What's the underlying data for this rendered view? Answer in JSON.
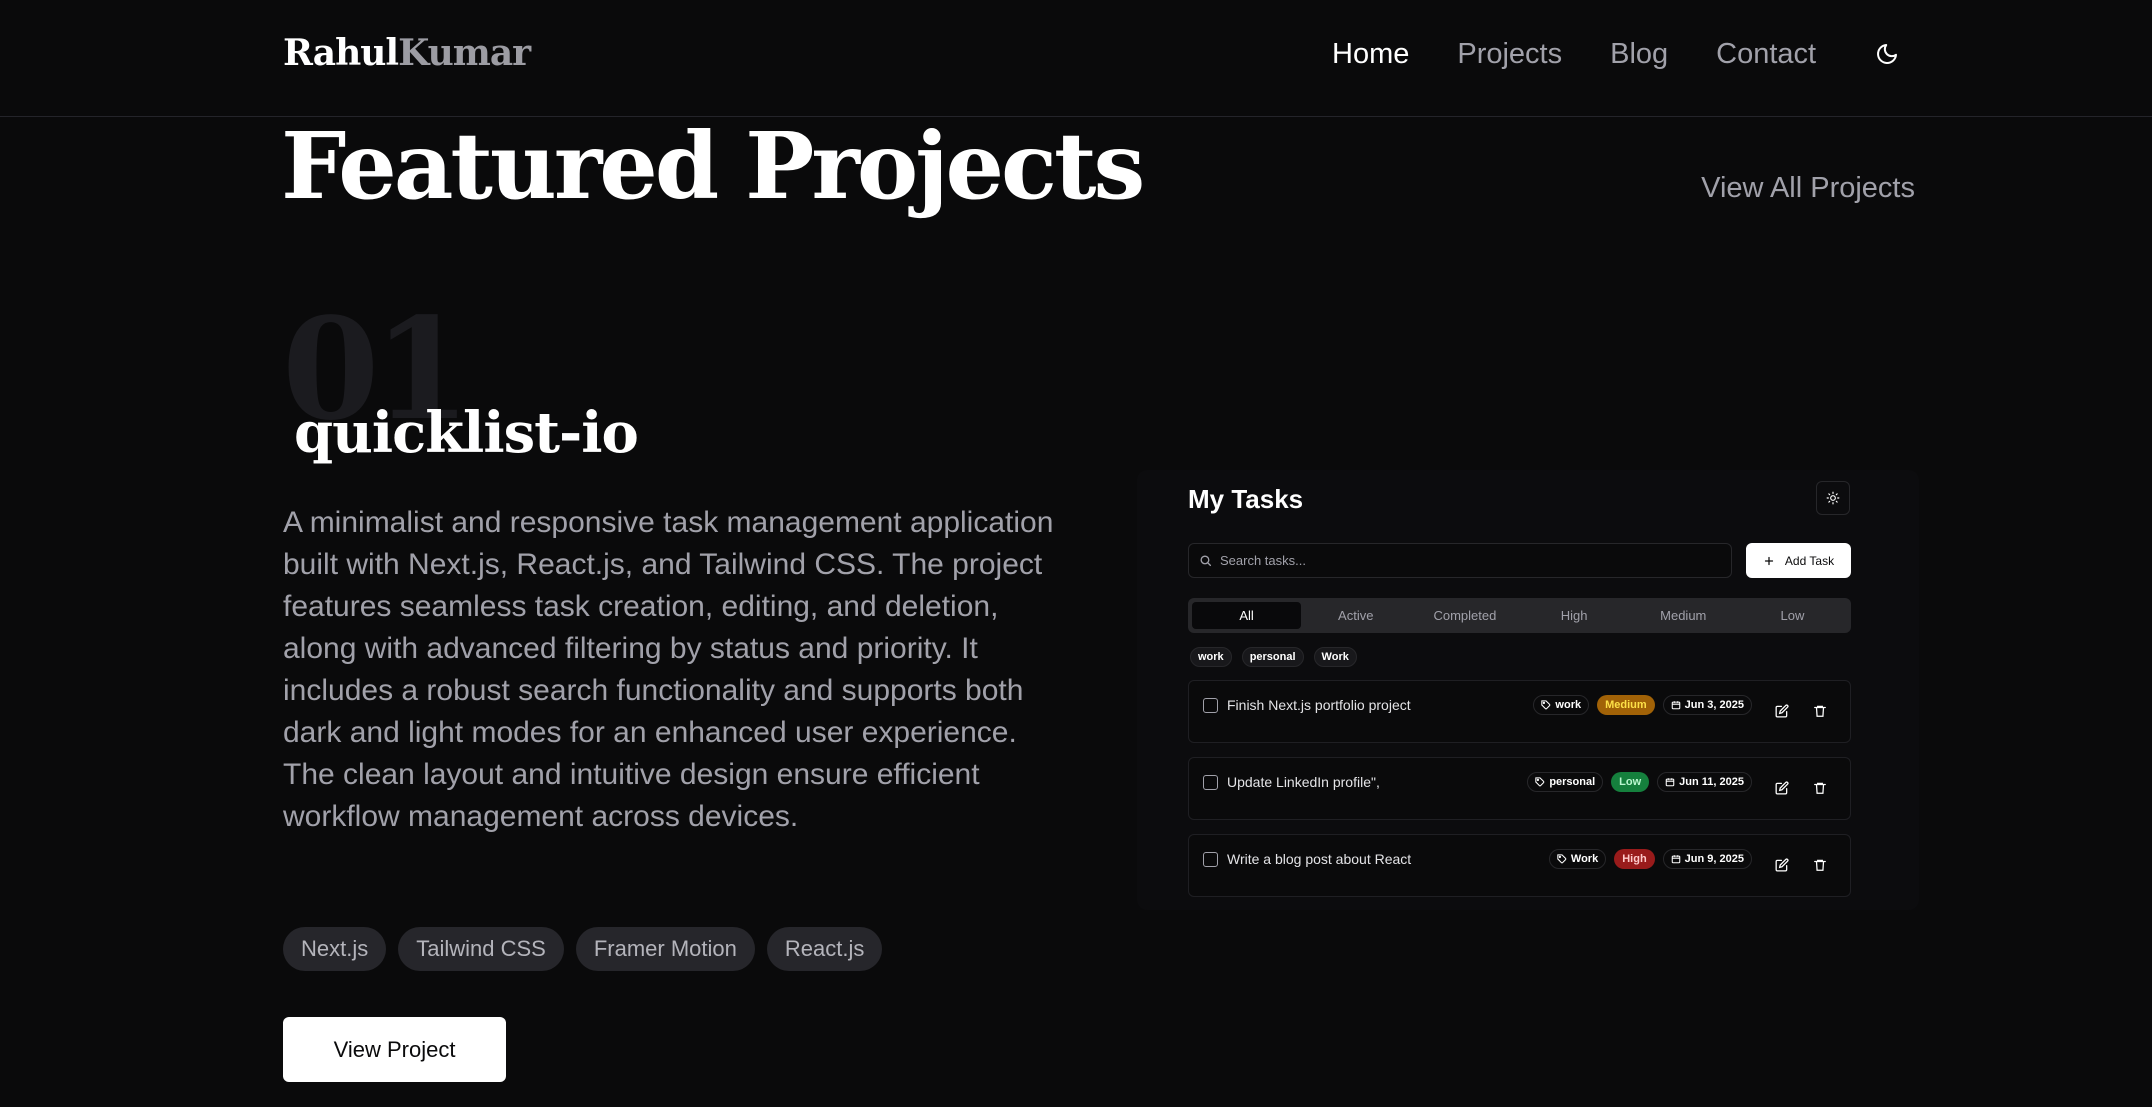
{
  "header": {
    "logo_first": "Rahul",
    "logo_last": "Kumar",
    "nav": [
      {
        "label": "Home",
        "active": true
      },
      {
        "label": "Projects",
        "active": false
      },
      {
        "label": "Blog",
        "active": false
      },
      {
        "label": "Contact",
        "active": false
      }
    ],
    "theme_icon": "moon-icon"
  },
  "section": {
    "title": "Featured Projects",
    "view_all": "View All Projects"
  },
  "project": {
    "number": "01",
    "title": "quicklist-io",
    "description": "A minimalist and responsive task management application built with Next.js, React.js, and Tailwind CSS. The project features seamless task creation, editing, and deletion, along with advanced filtering by status and priority. It includes a robust search functionality and supports both dark and light modes for an enhanced user experience. The clean layout and intuitive design ensure efficient workflow management across devices.",
    "tags": [
      "Next.js",
      "Tailwind CSS",
      "Framer Motion",
      "React.js"
    ],
    "cta": "View Project"
  },
  "preview": {
    "title": "My Tasks",
    "theme_icon": "sun-icon",
    "search_placeholder": "Search tasks...",
    "add_task": "Add Task",
    "filters": [
      "All",
      "Active",
      "Completed",
      "High",
      "Medium",
      "Low"
    ],
    "active_filter": "All",
    "categories": [
      "work",
      "personal",
      "Work"
    ],
    "tasks": [
      {
        "text": "Finish Next.js portfolio project",
        "category": "work",
        "priority": "Medium",
        "priority_bg": "#a16207",
        "priority_fg": "#fde047",
        "date": "Jun 3, 2025"
      },
      {
        "text": "Update LinkedIn profile\",",
        "category": "personal",
        "priority": "Low",
        "priority_bg": "#15803d",
        "priority_fg": "#bbf7d0",
        "date": "Jun 11, 2025"
      },
      {
        "text": "Write a blog post about React",
        "category": "Work",
        "priority": "High",
        "priority_bg": "#991b1b",
        "priority_fg": "#fecaca",
        "date": "Jun 9, 2025"
      }
    ]
  },
  "colors": {
    "background": "#0a0a0b",
    "text": "#fafafa",
    "muted": "#a1a1aa"
  }
}
